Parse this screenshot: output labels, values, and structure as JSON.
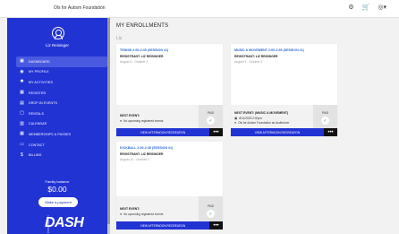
{
  "topbar": {
    "org_name": "Ols for Autism Foundation",
    "icons": [
      "gear-icon",
      "cart-icon",
      "user-icon"
    ],
    "gear_glyph": "⚙",
    "cart_glyph": "🛒",
    "user_glyph": "◎▾"
  },
  "sidebar": {
    "username": "Liz Reisinger",
    "nav": [
      {
        "label": "Dashboard",
        "icon": "dashboard-icon",
        "glyph": "▣"
      },
      {
        "label": "My Profile",
        "icon": "profile-icon",
        "glyph": "◉"
      },
      {
        "label": "My Activities",
        "icon": "activities-icon",
        "glyph": "✱"
      },
      {
        "label": "Register",
        "icon": "register-icon",
        "glyph": "▦"
      },
      {
        "label": "Drop-In Events",
        "icon": "dropin-icon",
        "glyph": "▤"
      },
      {
        "label": "Rentals",
        "icon": "rentals-icon",
        "glyph": "▢"
      },
      {
        "label": "Calendar",
        "icon": "calendar-icon",
        "glyph": "▥"
      },
      {
        "label": "Memberships & Passes",
        "icon": "memberships-icon",
        "glyph": "▦"
      },
      {
        "label": "Contact",
        "icon": "contact-icon",
        "glyph": "▭"
      },
      {
        "label": "Billing",
        "icon": "billing-icon",
        "glyph": "$"
      }
    ],
    "balance_label": "Family balance",
    "balance_value": "$0.00",
    "pay_button": "Make a payment",
    "logo_text": "DASH",
    "logo_tag": "POWERED BY"
  },
  "main": {
    "section_title": "MY ENROLLMENTS",
    "person": "Liz",
    "cards": [
      {
        "title": "TENNIS 2:00-2:45 (SESSION #1)",
        "registrant": "REGISTRANT: LIZ REISINGER",
        "dates": "August 4 - October 2",
        "event_label": "NEXT EVENT:",
        "event_lines": [
          {
            "icon": "info-icon",
            "glyph": "●",
            "text": "No upcoming registered events"
          }
        ],
        "paid_label": "PAID",
        "view_button": "VIEW AFTERNOON RECREATION",
        "more_button": "•••"
      },
      {
        "title": "MUSIC & MOVEMENT 2:00-2:45 (SESSION #1)",
        "registrant": "REGISTRANT: LIZ REISINGER",
        "dates": "August 4 - October 2",
        "event_label": "NEXT EVENT: (Music & Movement)",
        "event_lines": [
          {
            "icon": "calendar-icon",
            "glyph": "▣",
            "text": "8/11/2025 2:00pm"
          },
          {
            "icon": "location-icon",
            "glyph": "●",
            "text": "Ols for Autism Foundation an Auditorium"
          }
        ],
        "paid_label": "PAID",
        "view_button": "VIEW AFTERNOON RECREATION",
        "more_button": "•••"
      },
      {
        "title": "KICKBALL 2:00-2:45 (SESSION #1)",
        "registrant": "REGISTRANT: LIZ REISINGER",
        "dates": "August 10 - October 2",
        "event_label": "NEXT EVENT:",
        "event_lines": [
          {
            "icon": "info-icon",
            "glyph": "●",
            "text": "No upcoming registered events"
          }
        ],
        "paid_label": "PAID",
        "view_button": "VIEW AFTERNOON RECREATION",
        "more_button": "•••"
      }
    ],
    "check_glyph": "✓"
  },
  "colors": {
    "sidebar": "#2233d4",
    "accent_title": "#2b6ad6",
    "paid_check": "#34a853"
  }
}
